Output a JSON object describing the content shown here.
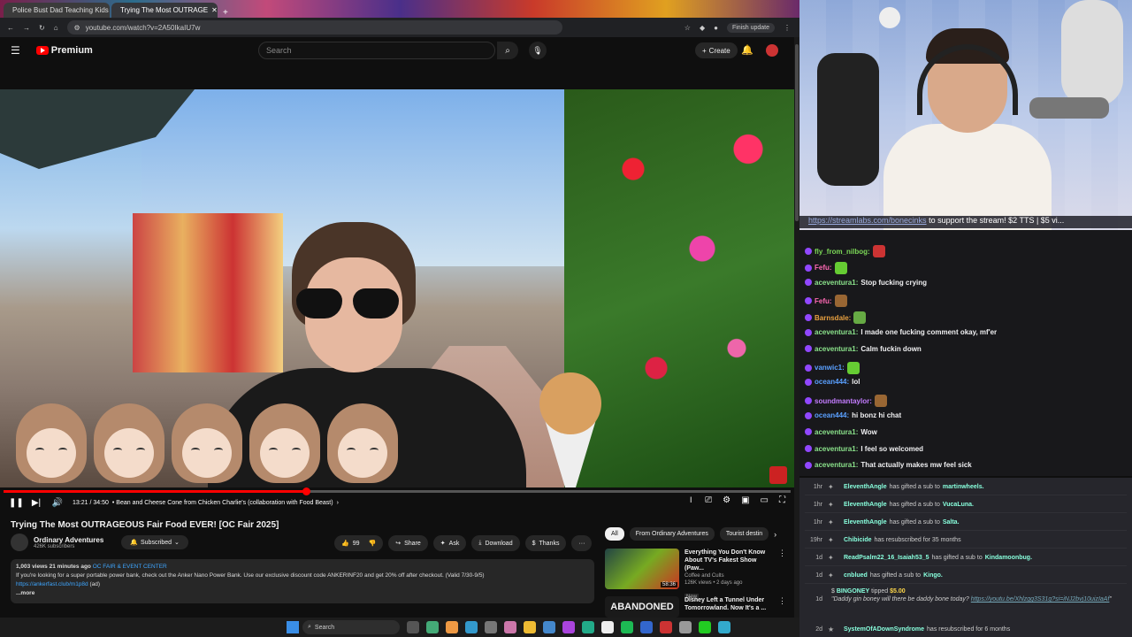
{
  "browser": {
    "tabs": [
      {
        "title": "Police Bust Dad Teaching Kids"
      },
      {
        "title": "Trying The Most OUTRAGE"
      }
    ],
    "url": "youtube.com/watch?v=2A50IkaIU7w",
    "finish_update": "Finish update",
    "window_controls": [
      "–",
      "▢",
      "✕"
    ]
  },
  "youtube": {
    "logo": "Premium",
    "search_placeholder": "Search",
    "create": "Create",
    "player": {
      "time": "13:21 / 34:50",
      "chapter": "• Bean and Cheese Cone from Chicken Charlie's (collaboration with Food Beast)",
      "chapter_arrow": "›",
      "progress_fraction": 0.384
    },
    "video": {
      "title": "Trying The Most OUTRAGEOUS Fair Food EVER! [OC Fair 2025]",
      "channel": "Ordinary Adventures",
      "subscribers": "426K subscribers",
      "subscribed": "Subscribed",
      "likes": "99",
      "share": "Share",
      "ask": "Ask",
      "download": "Download",
      "thanks": "Thanks",
      "more_actions": "···"
    },
    "description": {
      "stats": "1,003 views 21 minutes ago",
      "tag": "OC FAIR & EVENT CENTER",
      "line1": "If you're looking for a super portable power bank, check out the Anker Nano Power Bank. Use our exclusive discount code ANKERINF20 and get 20% off after checkout. (Valid 7/30-9/5)",
      "link": "https://ankerfast.club/m1p8d",
      "link_suffix": " (ad)",
      "more": "...more"
    },
    "chips": [
      "All",
      "From Ordinary Adventures",
      "Tourist destin"
    ],
    "recommendations": [
      {
        "title": "Everything You Don't Know About TV's Fakest Show (Paw...",
        "channel": "Coffee and Cults",
        "meta": "126K views • 2 days ago",
        "badge": "New",
        "duration": "58:36"
      },
      {
        "title": "Disney Left a Tunnel Under Tomorrowland. Now It's a ...",
        "thumb_text": "ABANDONED",
        "channel": "",
        "meta": "",
        "badge": "",
        "duration": ""
      }
    ]
  },
  "taskbar": {
    "search": "Search"
  },
  "stream": {
    "ticker_link": "https://streamlabs.com/bonecinks",
    "ticker_text": " to support the stream! $2 TTS | $5 vi..."
  },
  "chat": [
    {
      "user": "fly_from_nilbog:",
      "color": "#7cd957",
      "text": ""
    },
    {
      "user": "Fefu:",
      "color": "#ff69b4",
      "text": ""
    },
    {
      "user": "aceventura1:",
      "color": "#8be38b",
      "text": "Stop fucking crying"
    },
    {
      "user": "Fefu:",
      "color": "#ff69b4",
      "text": ""
    },
    {
      "user": "Barnsdale:",
      "color": "#e8a040",
      "text": ""
    },
    {
      "user": "aceventura1:",
      "color": "#8be38b",
      "text": "I made one fucking comment okay, mf'er"
    },
    {
      "user": "aceventura1:",
      "color": "#8be38b",
      "text": "Calm fuckin down"
    },
    {
      "user": "vanwic1:",
      "color": "#5aa0ff",
      "text": ""
    },
    {
      "user": "ocean444:",
      "color": "#5aa0ff",
      "text": "lol"
    },
    {
      "user": "soundmantaylor:",
      "color": "#c47cff",
      "text": ""
    },
    {
      "user": "ocean444:",
      "color": "#5aa0ff",
      "text": "hi bonz hi chat"
    },
    {
      "user": "aceventura1:",
      "color": "#8be38b",
      "text": "Wow"
    },
    {
      "user": "aceventura1:",
      "color": "#8be38b",
      "text": "I feel so welcomed"
    },
    {
      "user": "aceventura1:",
      "color": "#8be38b",
      "text": "That actually makes mw feel sick"
    }
  ],
  "events": [
    {
      "time": "1hr",
      "user": "EleventhAngle",
      "action": "has gifted a sub to",
      "target": "martinwheels."
    },
    {
      "time": "1hr",
      "user": "EleventhAngle",
      "action": "has gifted a sub to",
      "target": "VucaLuna."
    },
    {
      "time": "1hr",
      "user": "EleventhAngle",
      "action": "has gifted a sub to",
      "target": "Salta."
    },
    {
      "time": "19hr",
      "user": "Chibicide",
      "action": "has resubscribed for 35 months",
      "target": ""
    },
    {
      "time": "1d",
      "user": "ReadPsalm22_16_Isaiah53_5",
      "action": "has gifted a sub to",
      "target": "Kindamoonbug."
    },
    {
      "time": "1d",
      "user": "cnblued",
      "action": "has gifted a sub to",
      "target": "Kingo."
    }
  ],
  "tip": {
    "time": "1d",
    "user": "BINGONEY",
    "tipped": " tipped ",
    "amount": "$5.00",
    "message": "\"Daddy gin boney will there be daddy bone today? ",
    "link": "https://youtu.be/Xhlzgg3S31g?si=iNJ2bvj10uizIaAf",
    "end": "\""
  },
  "last_event": {
    "time": "2d",
    "user": "SystemOfADownSyndrome",
    "action": "has resubscribed for 6 months"
  },
  "colors": {
    "youtube_red": "#ff0000",
    "chat_bg": "#18181b",
    "link": "#3ea6ff"
  }
}
